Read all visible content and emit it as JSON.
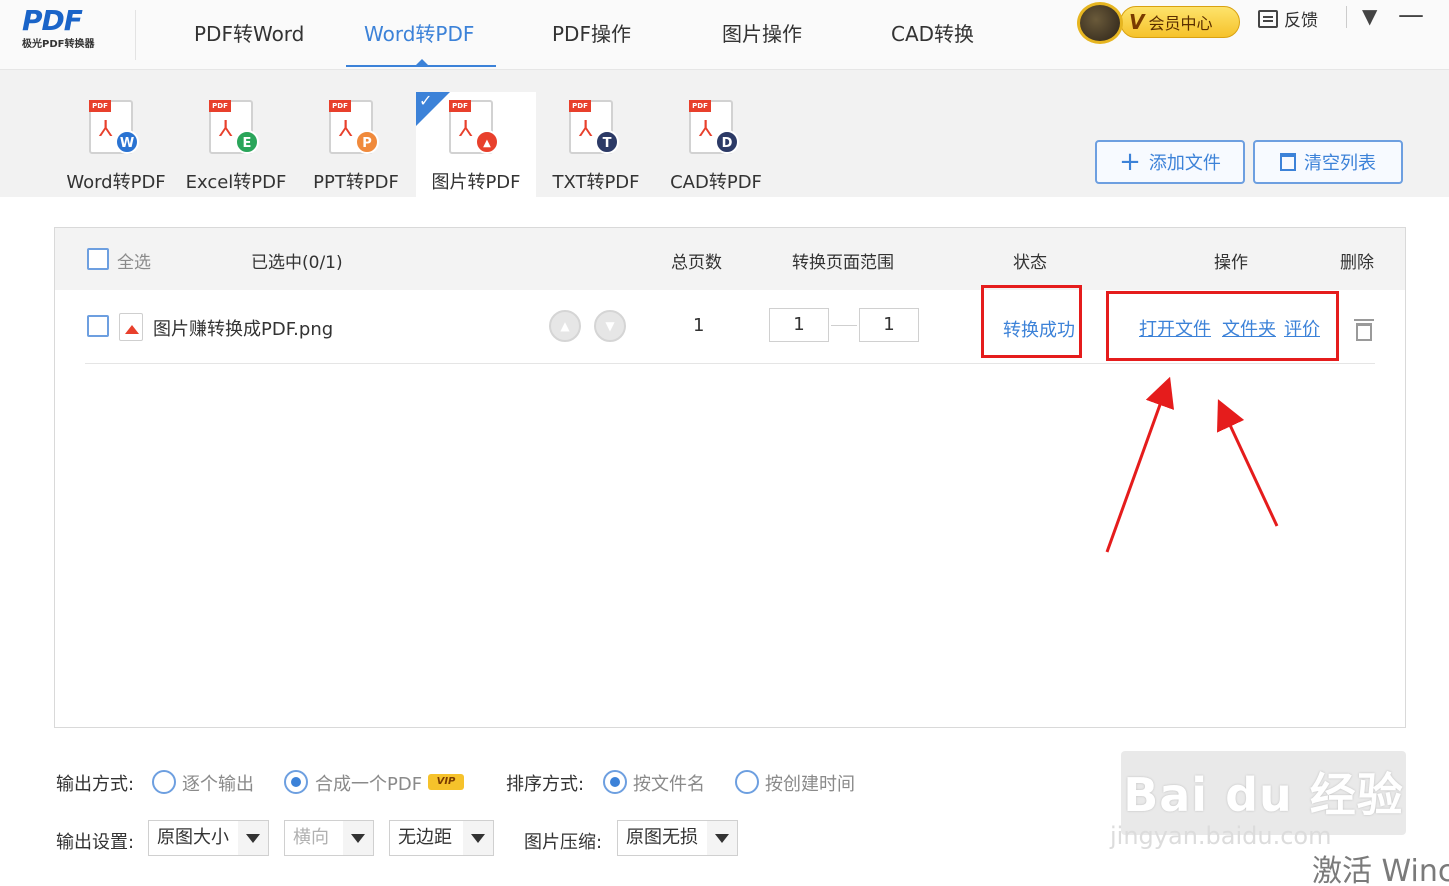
{
  "app": {
    "logo_text": "PDF",
    "logo_subtitle": "极光PDF转换器"
  },
  "nav": {
    "tabs": [
      {
        "label": "PDF转Word"
      },
      {
        "label": "Word转PDF"
      },
      {
        "label": "PDF操作"
      },
      {
        "label": "图片操作"
      },
      {
        "label": "CAD转换"
      }
    ],
    "active_tab": "Word转PDF",
    "vip_label": "会员中心",
    "feedback_label": "反馈"
  },
  "tools": {
    "items": [
      {
        "label": "Word转PDF",
        "badge": "W",
        "badge_color": "#2a73d2"
      },
      {
        "label": "Excel转PDF",
        "badge": "E",
        "badge_color": "#2aa55a"
      },
      {
        "label": "PPT转PDF",
        "badge": "P",
        "badge_color": "#f08a3c"
      },
      {
        "label": "图片转PDF",
        "badge": "▲",
        "badge_color": "#e8402c"
      },
      {
        "label": "TXT转PDF",
        "badge": "T",
        "badge_color": "#2c3a66"
      },
      {
        "label": "CAD转PDF",
        "badge": "D",
        "badge_color": "#2c3a66"
      }
    ],
    "active": "图片转PDF",
    "add_file_label": "添加文件",
    "clear_list_label": "清空列表"
  },
  "list": {
    "header": {
      "select_all": "全选",
      "selected_count": "已选中(0/1)",
      "total_pages": "总页数",
      "page_range": "转换页面范围",
      "status": "状态",
      "actions": "操作",
      "delete": "删除"
    },
    "rows": [
      {
        "filename": "图片赚转换成PDF.png",
        "total_pages": "1",
        "range_from": "1",
        "range_to": "1",
        "status": "转换成功",
        "action_open_file": "打开文件",
        "action_folder": "文件夹",
        "action_rate": "评价"
      }
    ]
  },
  "options": {
    "output_mode_label": "输出方式:",
    "output_individual": "逐个输出",
    "output_merge": "合成一个PDF",
    "output_merge_selected": true,
    "vip_badge": "VIP",
    "sort_label": "排序方式:",
    "sort_by_name": "按文件名",
    "sort_by_name_selected": true,
    "sort_by_time": "按创建时间",
    "output_settings_label": "输出设置:",
    "size_select": "原图大小",
    "orientation_select": "横向",
    "margin_select": "无边距",
    "compress_label": "图片压缩:",
    "compress_select": "原图无损"
  },
  "overlay": {
    "watermark": "Bai du 经验",
    "watermark_sub": "jingyan.baidu.com",
    "activate_text": "激活 Winc"
  },
  "colors": {
    "accent": "#3c82d8",
    "highlight_red": "#e51c1c",
    "vip_gold": "#f6c22b"
  }
}
